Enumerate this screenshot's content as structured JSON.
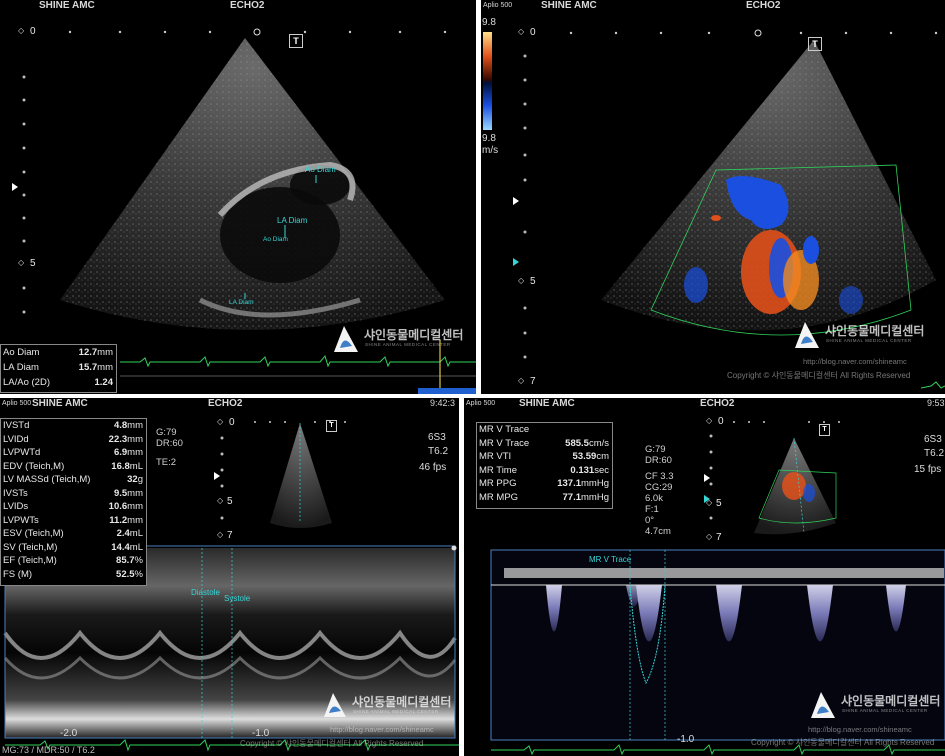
{
  "panels": {
    "top_left": {
      "device": "Aplio 500",
      "site": "SHINE AMC",
      "mode": "ECHO2",
      "depth_labels": [
        "0",
        "5"
      ],
      "t_marker": "T",
      "annotations": [
        "Ao Diam",
        "LA Diam",
        "Ao Diam",
        "LA Diam"
      ],
      "measurements": [
        {
          "label": "Ao Diam",
          "value": "12.7",
          "unit": "mm"
        },
        {
          "label": "LA Diam",
          "value": "15.7",
          "unit": "mm"
        },
        {
          "label": "LA/Ao (2D)",
          "value": "1.24",
          "unit": ""
        }
      ]
    },
    "top_right": {
      "device": "Aplio 500",
      "site": "SHINE AMC",
      "mode": "ECHO2",
      "scale_top": "9.8",
      "scale_bottom": "9.8",
      "scale_unit": "m/s",
      "depth_labels": [
        "0",
        "5",
        "7"
      ],
      "t_marker": "T",
      "url": "http://blog.naver.com/shineamc",
      "copyright": "Copyright © 샤인동물메디컬센터 All Rights Reserved"
    },
    "bottom_left": {
      "device": "Aplio 500",
      "site": "SHINE AMC",
      "mode": "ECHO2",
      "time": "9:42:3",
      "probe": "6S3",
      "sub": "T6.2",
      "fps": "46 fps",
      "params": [
        "G:79",
        "DR:60",
        "",
        "TE:2"
      ],
      "depth_labels": [
        "0",
        "5",
        "7"
      ],
      "t_marker": "T",
      "annotations": [
        "Diastole",
        "Systole"
      ],
      "axis_labels": [
        "-2.0",
        "-1.0"
      ],
      "footer": "MG:73  / MDR:50  / T6.2",
      "url": "http://blog.naver.com/shineamc",
      "copyright": "Copyright © 샤인동물메디컬센터 All Rights Reserved",
      "measurements": [
        {
          "label": "IVSTd",
          "value": "4.8",
          "unit": "mm"
        },
        {
          "label": "LVIDd",
          "value": "22.3",
          "unit": "mm"
        },
        {
          "label": "LVPWTd",
          "value": "6.9",
          "unit": "mm"
        },
        {
          "label": "EDV (Teich,M)",
          "value": "16.8",
          "unit": "mL"
        },
        {
          "label": "LV MASSd (Teich,M)",
          "value": "32",
          "unit": "g"
        },
        {
          "label": "IVSTs",
          "value": "9.5",
          "unit": "mm"
        },
        {
          "label": "LVIDs",
          "value": "10.6",
          "unit": "mm"
        },
        {
          "label": "LVPWTs",
          "value": "11.2",
          "unit": "mm"
        },
        {
          "label": "ESV (Teich,M)",
          "value": "2.4",
          "unit": "mL"
        },
        {
          "label": "SV (Teich,M)",
          "value": "14.4",
          "unit": "mL"
        },
        {
          "label": "EF (Teich,M)",
          "value": "85.7",
          "unit": "%"
        },
        {
          "label": "FS (M)",
          "value": "52.5",
          "unit": "%"
        }
      ]
    },
    "bottom_right": {
      "device": "Aplio 500",
      "site": "SHINE AMC",
      "mode": "ECHO2",
      "time": "9:53",
      "probe": "6S3",
      "sub": "T6.2",
      "fps": "15 fps",
      "params": [
        "G:79",
        "DR:60",
        "",
        "CF 3.3",
        "CG:29",
        "6.0k",
        "F:1",
        "0°",
        "4.7cm"
      ],
      "depth_labels": [
        "0",
        "5",
        "7"
      ],
      "t_marker": "T",
      "trace_label": "MR V Trace",
      "axis_labels": [
        "-1.0"
      ],
      "url": "http://blog.naver.com/shineamc",
      "copyright": "Copyright © 샤인동물메디컬센터 All Rights Reserved",
      "measurement_title": "MR V Trace",
      "measurements": [
        {
          "label": "MR V Trace",
          "value": "585.5",
          "unit": "cm/s"
        },
        {
          "label": "MR VTI",
          "value": "53.59",
          "unit": "cm"
        },
        {
          "label": "MR Time",
          "value": "0.131",
          "unit": "sec"
        },
        {
          "label": "MR PPG",
          "value": "137.1",
          "unit": "mmHg"
        },
        {
          "label": "MR MPG",
          "value": "77.1",
          "unit": "mmHg"
        }
      ]
    }
  },
  "logo": {
    "korean": "샤인동물메디컬센터",
    "english": "SHINE ANIMAL MEDICAL CENTER"
  },
  "colors": {
    "annotation": "#36d6d6",
    "ecg": "#2fd35a",
    "doppler_red": "#e0501a",
    "doppler_blue": "#1a4fe0"
  }
}
